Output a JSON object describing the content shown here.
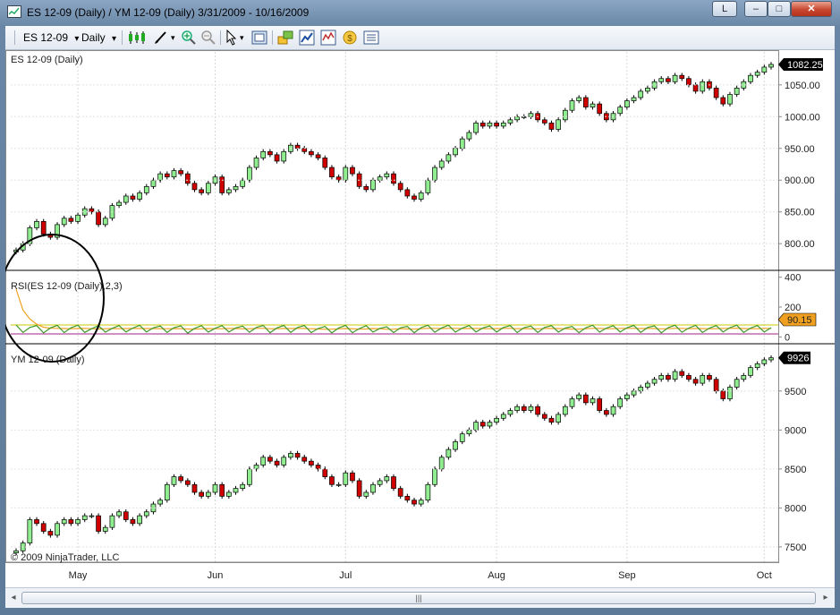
{
  "window": {
    "title": "ES 12-09 (Daily) / YM 12-09 (Daily)  3/31/2009 - 10/16/2009",
    "caption_buttons": {
      "layout": "L",
      "minimize": "–",
      "maximize": "□",
      "close": "✕"
    }
  },
  "toolbar": {
    "instrument": "ES 12-09",
    "interval": "Daily",
    "dropdown_arrow": "▾"
  },
  "panels": {
    "es": {
      "label": "ES 12-09 (Daily)",
      "last_price": "1082.25",
      "ticks": [
        "1050.00",
        "1000.00",
        "950.00",
        "900.00",
        "850.00",
        "800.00"
      ]
    },
    "rsi": {
      "label": "RSI(ES 12-09 (Daily),2,3)",
      "last_value": "90.15",
      "ticks": [
        "400",
        "200",
        "0"
      ]
    },
    "ym": {
      "label": "YM 12-09 (Daily)",
      "last_price": "9926",
      "ticks": [
        "9500",
        "9000",
        "8500",
        "8000",
        "7500"
      ]
    }
  },
  "copyright": "© 2009 NinjaTrader, LLC",
  "x_axis": {
    "months": [
      "May",
      "Jun",
      "Jul",
      "Aug",
      "Sep",
      "Oct"
    ]
  },
  "scrollbar": {
    "left_arrow": "◂",
    "right_arrow": "▸",
    "grip": "|||"
  },
  "colors": {
    "up_candle": "#90ee90",
    "down_candle": "#d00000",
    "rsi_line": "#3f9a2a",
    "rsi_signal": "#f0a020",
    "upper_level": "#c8c800",
    "lower_level": "#a0208a",
    "annotation_circle": "#000000"
  },
  "chart_data": [
    {
      "type": "candlestick",
      "series": [
        {
          "name": "ES 12-09 (Daily)",
          "y": [
            790,
            800,
            825,
            835,
            815,
            810,
            830,
            840,
            835,
            845,
            855,
            850,
            830,
            840,
            860,
            865,
            875,
            870,
            880,
            890,
            900,
            910,
            905,
            915,
            910,
            895,
            885,
            880,
            895,
            905,
            880,
            885,
            890,
            900,
            920,
            935,
            945,
            940,
            930,
            945,
            955,
            950,
            945,
            940,
            935,
            920,
            905,
            900,
            920,
            910,
            890,
            885,
            900,
            905,
            910,
            895,
            885,
            875,
            870,
            880,
            900,
            920,
            930,
            940,
            950,
            965,
            975,
            990,
            985,
            990,
            985,
            990,
            995,
            1000,
            1000,
            1005,
            995,
            990,
            980,
            995,
            1010,
            1025,
            1030,
            1015,
            1020,
            1005,
            995,
            1005,
            1015,
            1025,
            1030,
            1040,
            1045,
            1055,
            1060,
            1055,
            1065,
            1060,
            1050,
            1040,
            1055,
            1045,
            1030,
            1020,
            1035,
            1045,
            1055,
            1065,
            1070,
            1078,
            1082.25
          ]
        }
      ],
      "ylim": [
        765,
        1085
      ],
      "x_ticks": [
        "May",
        "Jun",
        "Jul",
        "Aug",
        "Sep",
        "Oct"
      ]
    },
    {
      "type": "line",
      "series": [
        {
          "name": "RSI",
          "y": [
            60,
            55,
            58,
            56,
            52,
            55,
            57,
            54,
            56,
            58,
            55,
            50,
            55,
            57,
            52,
            56,
            58,
            54,
            57,
            58,
            56,
            53,
            55,
            57,
            54,
            50,
            52,
            55,
            57,
            53,
            56,
            58,
            55,
            52,
            56,
            58,
            57,
            53,
            55,
            57,
            55,
            58,
            56,
            54,
            51,
            50,
            52,
            55,
            57,
            53,
            50,
            55,
            57,
            52,
            48,
            54,
            56,
            50,
            53,
            57,
            58,
            56,
            55,
            58,
            57,
            54,
            56,
            58,
            55,
            53,
            57,
            58,
            56,
            54,
            57,
            52,
            55,
            58,
            55,
            57,
            54,
            50,
            53,
            56,
            58,
            57,
            54,
            55,
            58,
            56,
            57,
            55,
            58,
            54,
            52,
            57,
            58,
            56,
            54,
            57,
            55,
            53,
            56,
            58,
            57,
            58,
            55,
            54,
            56,
            58,
            57
          ]
        },
        {
          "name": "RSI Avg",
          "y": [
            320,
            180,
            120,
            85,
            65,
            58,
            57,
            56,
            55,
            56,
            57,
            55,
            53,
            55,
            56,
            55,
            56,
            57,
            56,
            56,
            56,
            55,
            55,
            56,
            55,
            53,
            52,
            54,
            56,
            55,
            55,
            57,
            56,
            54,
            55,
            57,
            57,
            55,
            55,
            56,
            56,
            57,
            56,
            55,
            53,
            51,
            52,
            54,
            56,
            55,
            52,
            53,
            56,
            55,
            51,
            52,
            55,
            53,
            52,
            55,
            57,
            57,
            56,
            57,
            57,
            56,
            56,
            57,
            56,
            55,
            56,
            57,
            57,
            55,
            56,
            54,
            54,
            57,
            56,
            56,
            55,
            52,
            52,
            55,
            57,
            57,
            55,
            55,
            57,
            57,
            57,
            56,
            57,
            56,
            54,
            55,
            57,
            57,
            55,
            56,
            56,
            54,
            55,
            57,
            57,
            58,
            56,
            55,
            55,
            57,
            90.15
          ]
        }
      ],
      "levels": [
        80,
        20
      ],
      "ylim": [
        -40,
        440
      ]
    },
    {
      "type": "candlestick",
      "series": [
        {
          "name": "YM 12-09 (Daily)",
          "y": [
            7450,
            7550,
            7850,
            7800,
            7700,
            7650,
            7800,
            7850,
            7800,
            7850,
            7900,
            7900,
            7700,
            7750,
            7900,
            7950,
            7850,
            7800,
            7900,
            7950,
            8050,
            8100,
            8300,
            8400,
            8350,
            8300,
            8200,
            8150,
            8200,
            8300,
            8150,
            8200,
            8250,
            8300,
            8500,
            8550,
            8650,
            8600,
            8550,
            8650,
            8700,
            8650,
            8600,
            8550,
            8500,
            8400,
            8300,
            8300,
            8450,
            8350,
            8150,
            8200,
            8300,
            8350,
            8400,
            8250,
            8150,
            8100,
            8050,
            8100,
            8300,
            8500,
            8650,
            8750,
            8850,
            8950,
            9000,
            9100,
            9050,
            9100,
            9150,
            9200,
            9250,
            9300,
            9250,
            9300,
            9200,
            9150,
            9100,
            9200,
            9300,
            9400,
            9450,
            9350,
            9400,
            9250,
            9200,
            9300,
            9400,
            9450,
            9500,
            9550,
            9600,
            9650,
            9700,
            9650,
            9750,
            9700,
            9650,
            9600,
            9700,
            9650,
            9500,
            9400,
            9550,
            9650,
            9700,
            9800,
            9850,
            9900,
            9926
          ]
        }
      ],
      "ylim": [
        7350,
        9980
      ],
      "x_ticks": [
        "May",
        "Jun",
        "Jul",
        "Aug",
        "Sep",
        "Oct"
      ]
    }
  ]
}
